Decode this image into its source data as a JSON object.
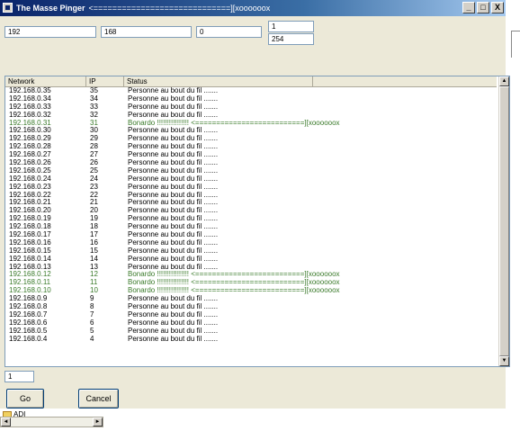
{
  "window": {
    "title": "The Masse Pinger",
    "title_suffix": "<=============================][xoooooox",
    "buttons": {
      "minimize": "_",
      "maximize": "□",
      "close": "X"
    }
  },
  "inputs": {
    "octet1": "192",
    "octet2": "168",
    "octet3": "0",
    "range_start": "1",
    "range_end": "254",
    "threads": "1"
  },
  "listview": {
    "columns": [
      "Network",
      "IP",
      "Status"
    ],
    "rows": [
      {
        "network": "192.168.0.35",
        "ip": "35",
        "status": "Personne au bout du fil ......."
      },
      {
        "network": "192.168.0.34",
        "ip": "34",
        "status": "Personne au bout du fil ......."
      },
      {
        "network": "192.168.0.33",
        "ip": "33",
        "status": "Personne au bout du fil ......."
      },
      {
        "network": "192.168.0.32",
        "ip": "32",
        "status": "Personne au bout du fil ......."
      },
      {
        "network": "192.168.0.31",
        "ip": "31",
        "status": "Bonardo !!!!!!!!!!!!!!!!  <==========================][xoooooox",
        "found": true
      },
      {
        "network": "192.168.0.30",
        "ip": "30",
        "status": "Personne au bout du fil ......."
      },
      {
        "network": "192.168.0.29",
        "ip": "29",
        "status": "Personne au bout du fil ......."
      },
      {
        "network": "192.168.0.28",
        "ip": "28",
        "status": "Personne au bout du fil ......."
      },
      {
        "network": "192.168.0.27",
        "ip": "27",
        "status": "Personne au bout du fil ......."
      },
      {
        "network": "192.168.0.26",
        "ip": "26",
        "status": "Personne au bout du fil ......."
      },
      {
        "network": "192.168.0.25",
        "ip": "25",
        "status": "Personne au bout du fil ......."
      },
      {
        "network": "192.168.0.24",
        "ip": "24",
        "status": "Personne au bout du fil ......."
      },
      {
        "network": "192.168.0.23",
        "ip": "23",
        "status": "Personne au bout du fil ......."
      },
      {
        "network": "192.168.0.22",
        "ip": "22",
        "status": "Personne au bout du fil ......."
      },
      {
        "network": "192.168.0.21",
        "ip": "21",
        "status": "Personne au bout du fil ......."
      },
      {
        "network": "192.168.0.20",
        "ip": "20",
        "status": "Personne au bout du fil ......."
      },
      {
        "network": "192.168.0.19",
        "ip": "19",
        "status": "Personne au bout du fil ......."
      },
      {
        "network": "192.168.0.18",
        "ip": "18",
        "status": "Personne au bout du fil ......."
      },
      {
        "network": "192.168.0.17",
        "ip": "17",
        "status": "Personne au bout du fil ......."
      },
      {
        "network": "192.168.0.16",
        "ip": "16",
        "status": "Personne au bout du fil ......."
      },
      {
        "network": "192.168.0.15",
        "ip": "15",
        "status": "Personne au bout du fil ......."
      },
      {
        "network": "192.168.0.14",
        "ip": "14",
        "status": "Personne au bout du fil ......."
      },
      {
        "network": "192.168.0.13",
        "ip": "13",
        "status": "Personne au bout du fil ......."
      },
      {
        "network": "192.168.0.12",
        "ip": "12",
        "status": "Bonardo !!!!!!!!!!!!!!!!  <==========================][xoooooox",
        "found": true
      },
      {
        "network": "192.168.0.11",
        "ip": "11",
        "status": "Bonardo !!!!!!!!!!!!!!!!  <==========================][xoooooox",
        "found": true
      },
      {
        "network": "192.168.0.10",
        "ip": "10",
        "status": "Bonardo !!!!!!!!!!!!!!!!  <==========================][xoooooox",
        "found": true
      },
      {
        "network": "192.168.0.9",
        "ip": "9",
        "status": "Personne au bout du fil ......."
      },
      {
        "network": "192.168.0.8",
        "ip": "8",
        "status": "Personne au bout du fil ......."
      },
      {
        "network": "192.168.0.7",
        "ip": "7",
        "status": "Personne au bout du fil ......."
      },
      {
        "network": "192.168.0.6",
        "ip": "6",
        "status": "Personne au bout du fil ......."
      },
      {
        "network": "192.168.0.5",
        "ip": "5",
        "status": "Personne au bout du fil ......."
      },
      {
        "network": "192.168.0.4",
        "ip": "4",
        "status": "Personne au bout du fil ......."
      }
    ]
  },
  "buttons": {
    "go": "Go",
    "cancel": "Cancel"
  },
  "taskbar": {
    "folder_label": "ADI"
  },
  "colors": {
    "found_row": "#3a7a2a",
    "titlebar": "#0a246a"
  },
  "icons": {
    "app": "app-icon",
    "folder": "folder-icon",
    "scroll_up": "arrow-up-icon",
    "scroll_down": "arrow-down-icon"
  }
}
